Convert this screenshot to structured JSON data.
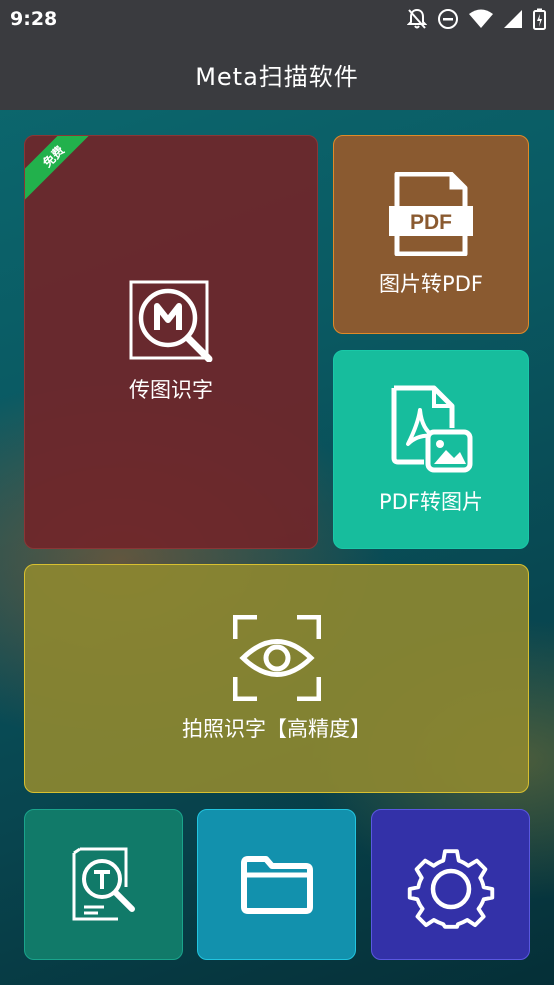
{
  "status_bar": {
    "time": "9:28",
    "icons": [
      "notifications-off-icon",
      "do-not-disturb-icon",
      "wifi-icon",
      "signal-icon",
      "battery-charging-icon"
    ]
  },
  "app_bar": {
    "title": "Meta扫描软件"
  },
  "tiles": {
    "upload_ocr": {
      "label": "传图识字",
      "badge": "免费",
      "icon": "ocr-m-icon",
      "color": "#70262a"
    },
    "image_to_pdf": {
      "label": "图片转PDF",
      "icon": "pdf-file-icon",
      "icon_text": "PDF",
      "color": "#8a5a30"
    },
    "pdf_to_image": {
      "label": "PDF转图片",
      "icon": "pdf-to-image-icon",
      "color": "#17bd9d"
    },
    "photo_ocr": {
      "label": "拍照识字【高精度】",
      "icon": "eye-scan-icon",
      "color": "#8c8730"
    },
    "text_scan": {
      "icon": "text-scan-icon",
      "color": "#117a69"
    },
    "files": {
      "icon": "folder-icon",
      "color": "#1291ad"
    },
    "settings": {
      "icon": "gear-icon",
      "color": "#3331a8"
    }
  }
}
